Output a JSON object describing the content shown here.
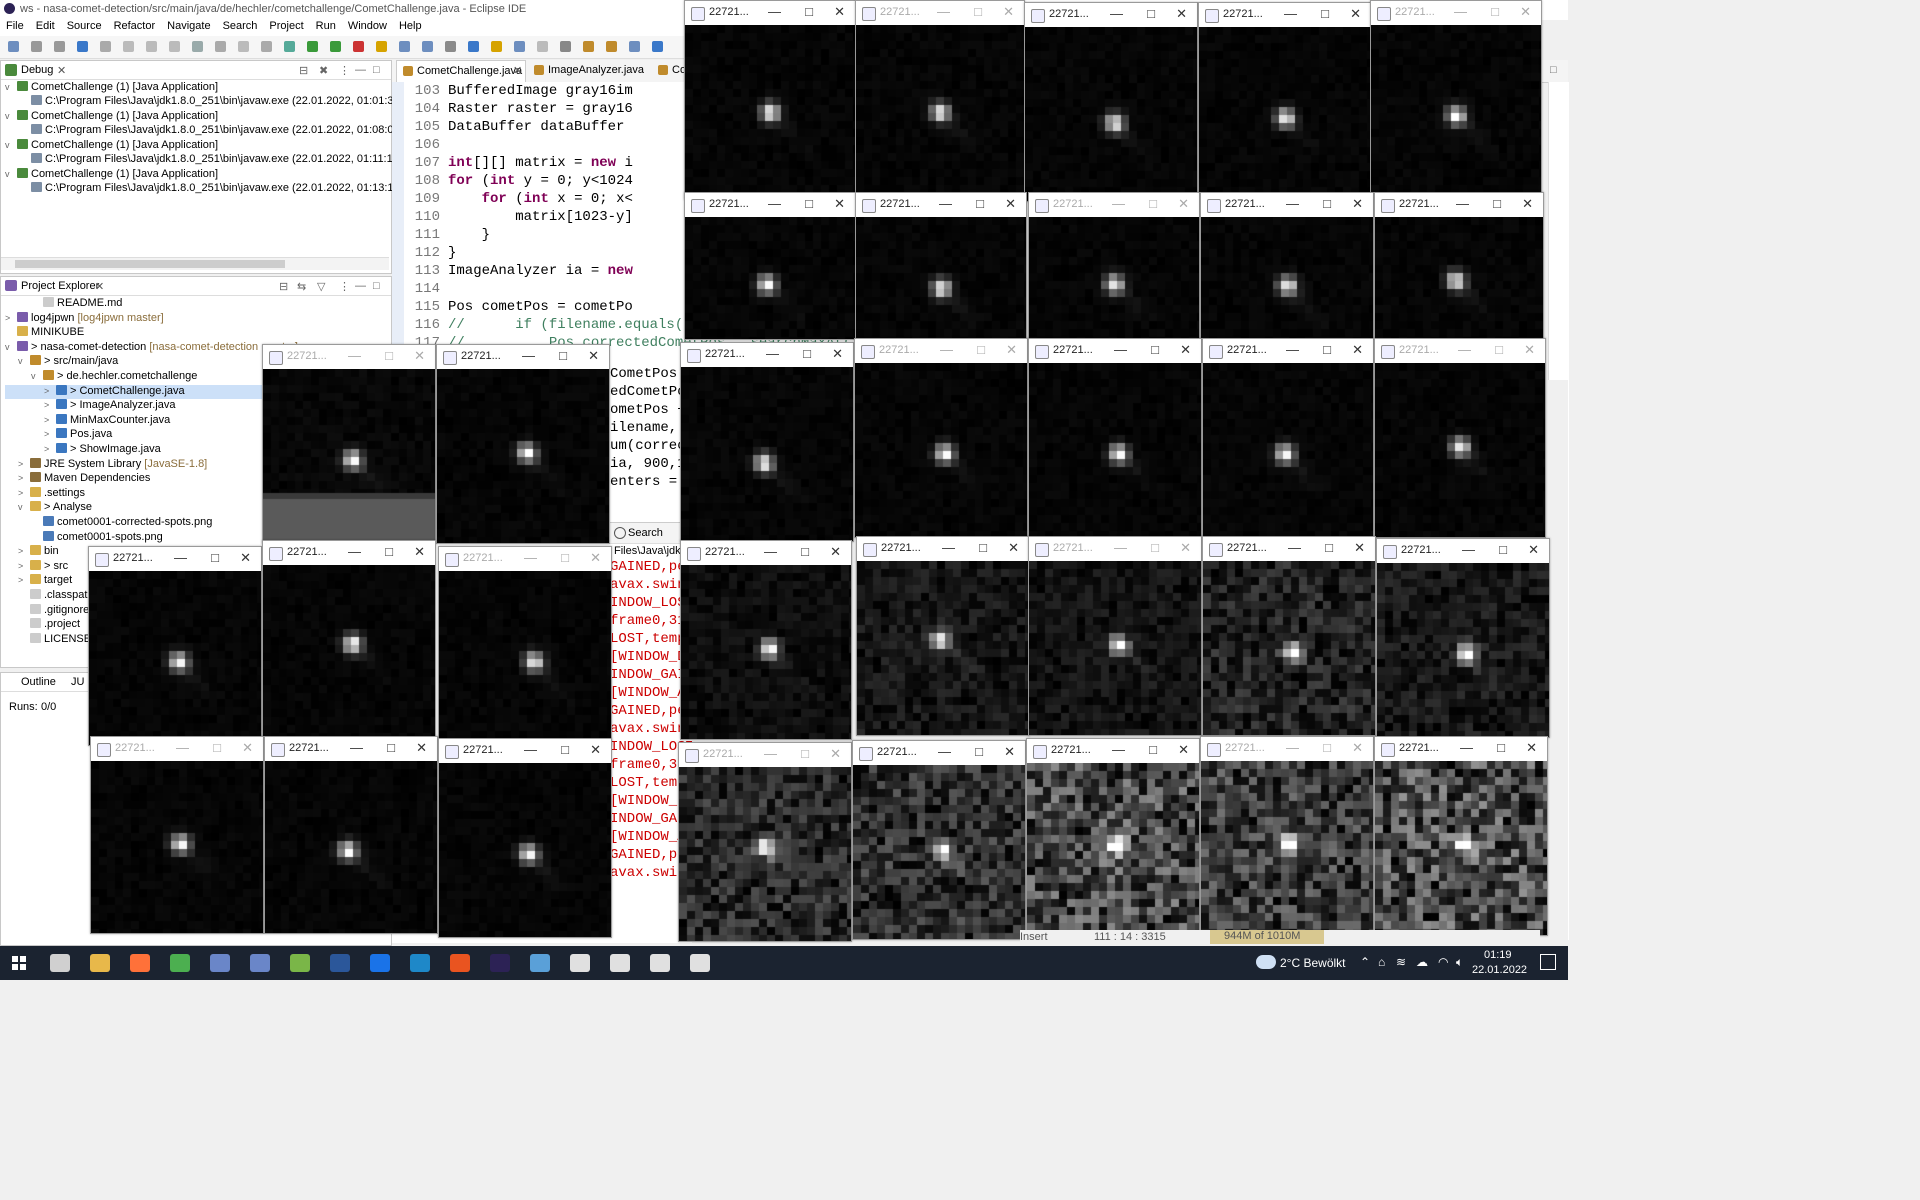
{
  "window": {
    "title": "ws - nasa-comet-detection/src/main/java/de/hechler/cometchallenge/CometChallenge.java - Eclipse IDE"
  },
  "menu": [
    "File",
    "Edit",
    "Source",
    "Refactor",
    "Navigate",
    "Search",
    "Project",
    "Run",
    "Window",
    "Help"
  ],
  "debug_view": {
    "tab": "Debug",
    "items": [
      {
        "launch": "CometChallenge (1) [Java Application]",
        "process": "C:\\Program Files\\Java\\jdk1.8.0_251\\bin\\javaw.exe (22.01.2022, 01:01:32)"
      },
      {
        "launch": "CometChallenge (1) [Java Application]",
        "process": "C:\\Program Files\\Java\\jdk1.8.0_251\\bin\\javaw.exe (22.01.2022, 01:08:02)"
      },
      {
        "launch": "CometChallenge (1) [Java Application]",
        "process": "C:\\Program Files\\Java\\jdk1.8.0_251\\bin\\javaw.exe (22.01.2022, 01:11:12)"
      },
      {
        "launch": "CometChallenge (1) [Java Application]",
        "process": "C:\\Program Files\\Java\\jdk1.8.0_251\\bin\\javaw.exe (22.01.2022, 01:13:18)"
      }
    ]
  },
  "project_explorer": {
    "tab": "Project Explorer",
    "rows": [
      {
        "indent": 2,
        "arrow": "",
        "icon": "file",
        "label": "README.md",
        "deco": ""
      },
      {
        "indent": 0,
        "arrow": ">",
        "icon": "project",
        "label": "log4jpwn",
        "deco": "[log4jpwn master]"
      },
      {
        "indent": 0,
        "arrow": "",
        "icon": "folder",
        "label": "MINIKUBE",
        "deco": ""
      },
      {
        "indent": 0,
        "arrow": "v",
        "icon": "project",
        "label": "> nasa-comet-detection",
        "deco": "[nasa-comet-detection master]"
      },
      {
        "indent": 1,
        "arrow": "v",
        "icon": "srcfolder",
        "label": "> src/main/java",
        "deco": ""
      },
      {
        "indent": 2,
        "arrow": "v",
        "icon": "package",
        "label": "> de.hechler.cometchallenge",
        "deco": ""
      },
      {
        "indent": 3,
        "arrow": ">",
        "icon": "java",
        "label": "> CometChallenge.java",
        "deco": "",
        "selected": true
      },
      {
        "indent": 3,
        "arrow": ">",
        "icon": "java",
        "label": "> ImageAnalyzer.java",
        "deco": ""
      },
      {
        "indent": 3,
        "arrow": ">",
        "icon": "java",
        "label": "MinMaxCounter.java",
        "deco": ""
      },
      {
        "indent": 3,
        "arrow": ">",
        "icon": "java",
        "label": "Pos.java",
        "deco": ""
      },
      {
        "indent": 3,
        "arrow": ">",
        "icon": "java",
        "label": "> ShowImage.java",
        "deco": ""
      },
      {
        "indent": 1,
        "arrow": ">",
        "icon": "library",
        "label": "JRE System Library",
        "deco": "[JavaSE-1.8]"
      },
      {
        "indent": 1,
        "arrow": ">",
        "icon": "library",
        "label": "Maven Dependencies",
        "deco": ""
      },
      {
        "indent": 1,
        "arrow": ">",
        "icon": "folder",
        "label": ".settings",
        "deco": ""
      },
      {
        "indent": 1,
        "arrow": "v",
        "icon": "folder",
        "label": "> Analyse",
        "deco": ""
      },
      {
        "indent": 2,
        "arrow": "",
        "icon": "image",
        "label": "comet0001-corrected-spots.png",
        "deco": ""
      },
      {
        "indent": 2,
        "arrow": "",
        "icon": "image",
        "label": "comet0001-spots.png",
        "deco": ""
      },
      {
        "indent": 1,
        "arrow": ">",
        "icon": "folder",
        "label": "bin",
        "deco": ""
      },
      {
        "indent": 1,
        "arrow": ">",
        "icon": "folder",
        "label": "> src",
        "deco": ""
      },
      {
        "indent": 1,
        "arrow": ">",
        "icon": "folder",
        "label": "target",
        "deco": ""
      },
      {
        "indent": 1,
        "arrow": "",
        "icon": "file",
        "label": ".classpath",
        "deco": ""
      },
      {
        "indent": 1,
        "arrow": "",
        "icon": "file",
        "label": ".gitignore",
        "deco": ""
      },
      {
        "indent": 1,
        "arrow": "",
        "icon": "file",
        "label": ".project",
        "deco": ""
      },
      {
        "indent": 1,
        "arrow": "",
        "icon": "file",
        "label": "LICENSE",
        "deco": ""
      }
    ]
  },
  "outline": {
    "tabs": [
      "Outline",
      "JU"
    ],
    "runs_label": "Runs:",
    "runs_value": "0/0"
  },
  "editor": {
    "tabs": [
      "CometChallenge.java",
      "ImageAnalyzer.java",
      "Co"
    ],
    "lines": [
      {
        "n": "103",
        "code": "BufferedImage gray16im"
      },
      {
        "n": "104",
        "code": "Raster raster = gray16"
      },
      {
        "n": "105",
        "code": "DataBuffer dataBuffer "
      },
      {
        "n": "106",
        "code": ""
      },
      {
        "n": "107",
        "code": "int[][] matrix = new i"
      },
      {
        "n": "108",
        "code": "for (int y = 0; y<1024"
      },
      {
        "n": "109",
        "code": "    for (int x = 0; x<"
      },
      {
        "n": "110",
        "code": "        matrix[1023-y]"
      },
      {
        "n": "111",
        "code": "    }"
      },
      {
        "n": "112",
        "code": "}"
      },
      {
        "n": "113",
        "code": "ImageAnalyzer ia = new"
      },
      {
        "n": "114",
        "code": ""
      },
      {
        "n": "115",
        "code": "Pos cometPos = cometPo"
      },
      {
        "n": "116",
        "code": "//      if (filename.equals(\"2"
      },
      {
        "n": "117",
        "code": "//          Pos correctedCometPos = searchMaxAt("
      }
    ],
    "partial_lines": [
      "CometPos",
      "edCometPo",
      "ometPos +",
      "ilename,",
      "um(correc",
      "ia, 900,1",
      "enters ="
    ]
  },
  "console": {
    "search_tab": "Search",
    "path_fragment": "Files\\Java\\jdk1",
    "lines": [
      "GAINED,pe",
      "avax.swin",
      "INDOW_LOS",
      "frame0,31",
      "LOST,temp",
      "[WINDOW_D",
      "INDOW_GAI",
      "[WINDOW_A",
      "GAINED,pe",
      "avax.swin",
      "INDOW_LOST_FOCUS,opposite=jav",
      "frame0,31",
      "LOST,temp",
      "[WINDOW_D",
      "INDOW_GAI",
      "[WINDOW_A",
      "GAINED,pe",
      "avax.swin"
    ],
    "status": {
      "insert": "Insert",
      "memory": "944M of 1010M",
      "position": "111 : 14 : 3315"
    }
  },
  "image_windows": {
    "title": "22721..."
  },
  "taskbar": {
    "weather": "2°C Bewölkt",
    "time": "01:19",
    "date": "22.01.2022"
  },
  "colors": {
    "editor_bg": "#ffffff",
    "keyword": "#7f0055",
    "console_error": "#cc0000",
    "taskbar": "#1b2330"
  }
}
